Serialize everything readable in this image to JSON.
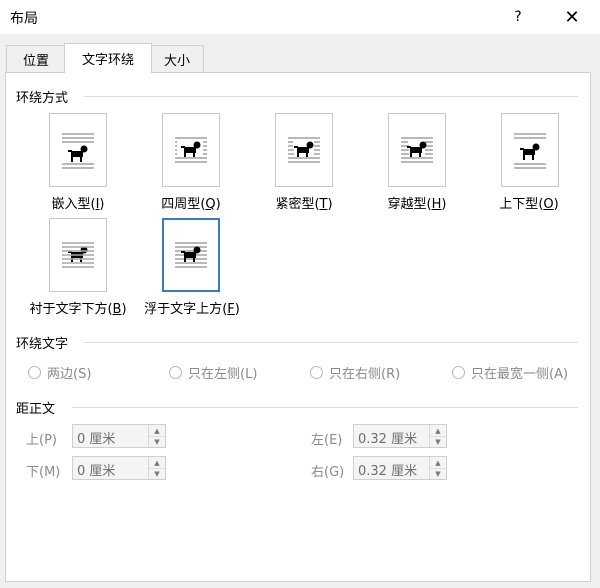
{
  "window": {
    "title": "布局",
    "help_label": "?",
    "close_label": "✕"
  },
  "tabs": [
    {
      "label": "位置"
    },
    {
      "label": "文字环绕"
    },
    {
      "label": "大小"
    }
  ],
  "active_tab": "文字环绕",
  "wrap_section": {
    "title": "环绕方式",
    "options": [
      {
        "name": "嵌入型",
        "mnemonic": "I",
        "icon": "inline-wrap-icon"
      },
      {
        "name": "四周型",
        "mnemonic": "Q",
        "icon": "square-wrap-icon"
      },
      {
        "name": "紧密型",
        "mnemonic": "T",
        "icon": "tight-wrap-icon"
      },
      {
        "name": "穿越型",
        "mnemonic": "H",
        "icon": "through-wrap-icon"
      },
      {
        "name": "上下型",
        "mnemonic": "O",
        "icon": "top-bottom-wrap-icon"
      },
      {
        "name": "衬于文字下方",
        "mnemonic": "B",
        "icon": "behind-text-icon"
      },
      {
        "name": "浮于文字上方",
        "mnemonic": "F",
        "icon": "in-front-of-text-icon"
      }
    ],
    "selected": "浮于文字上方"
  },
  "wrap_text_section": {
    "title": "环绕文字",
    "options": [
      "两边(S)",
      "只在左侧(L)",
      "只在右侧(R)",
      "只在最宽一侧(A)"
    ]
  },
  "distance_section": {
    "title": "距正文",
    "fields": [
      {
        "label": "上(P)",
        "value": "0 厘米"
      },
      {
        "label": "下(M)",
        "value": "0 厘米"
      },
      {
        "label": "左(E)",
        "value": "0.32 厘米"
      },
      {
        "label": "右(G)",
        "value": "0.32 厘米"
      }
    ]
  },
  "colors": {
    "selection": "#3c78c8",
    "disabled_text": "#8a8a8a",
    "panel_bg": "#ffffff",
    "dialog_bg": "#f0f0f0"
  }
}
